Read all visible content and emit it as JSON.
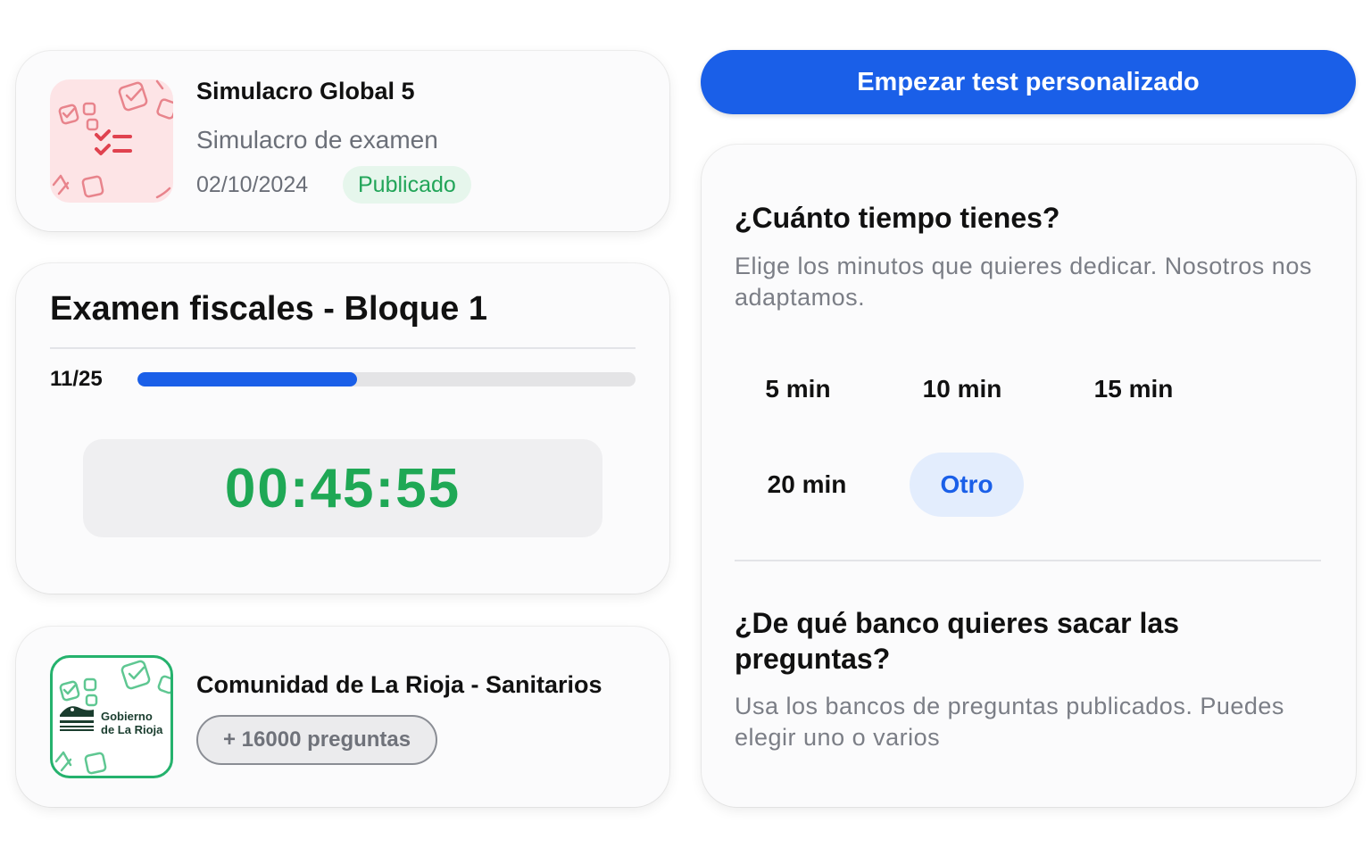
{
  "simulacro": {
    "title": "Simulacro Global 5",
    "subtitle": "Simulacro de examen",
    "date": "02/10/2024",
    "status": "Publicado"
  },
  "exam": {
    "title": "Examen fiscales - Bloque 1",
    "progress_label": "11/25",
    "progress_fraction": 0.44,
    "timer": "00:45:55"
  },
  "bank": {
    "logo_line1": "Gobierno",
    "logo_line2": "de La Rioja",
    "title": "Comunidad de La Rioja - Sanitarios",
    "questions": "+ 16000 preguntas"
  },
  "start_button": "Empezar test personalizado",
  "time_section": {
    "question": "¿Cuánto tiempo tienes?",
    "description": "Elige los minutos que quieres dedicar. Nosotros nos adaptamos.",
    "options": [
      "5 min",
      "10 min",
      "15 min",
      "20 min",
      "Otro"
    ],
    "selected": "Otro"
  },
  "bank_section": {
    "question": "¿De qué banco quieres sacar las preguntas?",
    "description": "Usa los bancos de preguntas publicados. Puedes elegir uno o varios"
  },
  "colors": {
    "accent": "#1a5fe8",
    "success": "#1fa855",
    "badge_bg": "#e6f6ec",
    "thumb_bg": "#fde4e6"
  }
}
